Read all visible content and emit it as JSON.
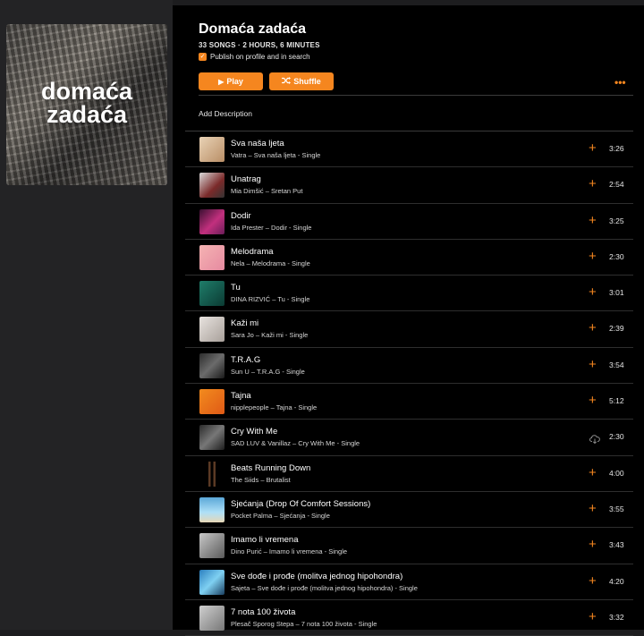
{
  "sidebar": {
    "artwork_title": "domaća zadaća"
  },
  "playlist": {
    "title": "Domaća zadaća",
    "meta": "33 SONGS · 2 HOURS, 6 MINUTES",
    "publish_label": "Publish on profile and in search",
    "publish_checked": true,
    "play_label": "Play",
    "shuffle_label": "Shuffle",
    "more_label": "•••",
    "add_description": "Add Description"
  },
  "colors": {
    "accent": "#f5861f",
    "background": "#000000"
  },
  "tracks": [
    {
      "title": "Sva naša ljeta",
      "subtitle": "Vatra – Sva naša ljeta - Single",
      "duration": "3:26",
      "action_icon": "plus-icon"
    },
    {
      "title": "Unatrag",
      "subtitle": "Mia Dimšić – Sretan Put",
      "duration": "2:54",
      "action_icon": "plus-icon"
    },
    {
      "title": "Dodir",
      "subtitle": "Ida Prester – Dodir - Single",
      "duration": "3:25",
      "action_icon": "plus-icon"
    },
    {
      "title": "Melodrama",
      "subtitle": "Nela – Melodrama - Single",
      "duration": "2:30",
      "action_icon": "plus-icon"
    },
    {
      "title": "Tu",
      "subtitle": "DINA RIZVIĆ – Tu - Single",
      "duration": "3:01",
      "action_icon": "plus-icon"
    },
    {
      "title": "Kaži mi",
      "subtitle": "Sara Jo – Kaži mi - Single",
      "duration": "2:39",
      "action_icon": "plus-icon"
    },
    {
      "title": "T.R.A.G",
      "subtitle": "Sun U – T.R.A.G - Single",
      "duration": "3:54",
      "action_icon": "plus-icon"
    },
    {
      "title": "Tajna",
      "subtitle": "nipplepeople – Tajna - Single",
      "duration": "5:12",
      "action_icon": "plus-icon"
    },
    {
      "title": "Cry With Me",
      "subtitle": "SAD LUV & Vanillaz – Cry With Me - Single",
      "duration": "2:30",
      "action_icon": "cloud-download-icon"
    },
    {
      "title": "Beats Running Down",
      "subtitle": "The Siids – Brutalist",
      "duration": "4:00",
      "action_icon": "plus-icon"
    },
    {
      "title": "Sjećanja (Drop Of Comfort Sessions)",
      "subtitle": "Pocket Palma – Sjećanja - Single",
      "duration": "3:55",
      "action_icon": "plus-icon"
    },
    {
      "title": "Imamo li vremena",
      "subtitle": "Dino Purić – Imamo li vremena - Single",
      "duration": "3:43",
      "action_icon": "plus-icon"
    },
    {
      "title": "Sve dođe i prođe (molitva jednog hipohondra)",
      "subtitle": "Sajeta – Sve dođe i prođe (molitva jednog hipohondra) - Single",
      "duration": "4:20",
      "action_icon": "plus-icon"
    },
    {
      "title": "7 nota 100 života",
      "subtitle": "Plesač Sporog Stepa – 7 nota 100 života - Single",
      "duration": "3:32",
      "action_icon": "plus-icon"
    }
  ]
}
